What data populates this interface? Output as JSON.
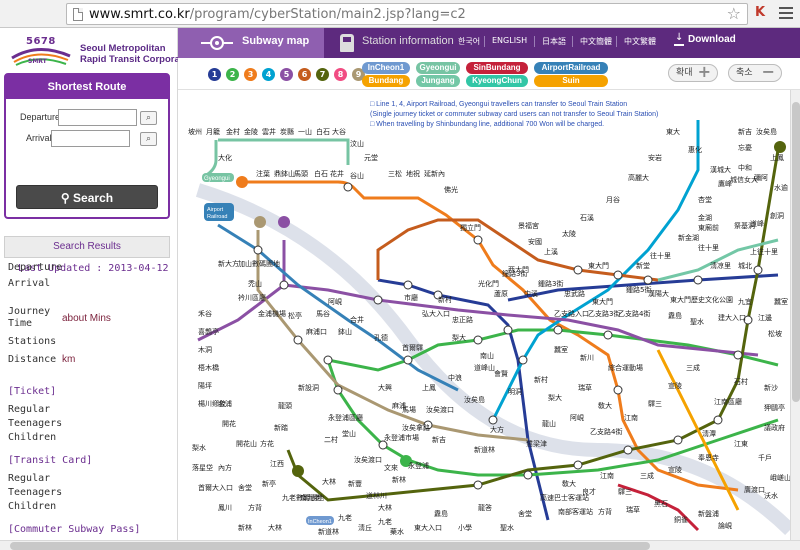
{
  "browser": {
    "url_host": "www.smrt.co.kr",
    "url_path": "/program/cyberStation/main2.jsp?lang=c2"
  },
  "logo": {
    "number": "5678",
    "sub": "SMRT",
    "line1": "Seoul Metropolitan",
    "line2": "Rapid Transit Corporation"
  },
  "route": {
    "title": "Shortest Route",
    "departure_label": "Departure",
    "arrival_label": "Arrival",
    "departure_value": "",
    "arrival_value": "",
    "search_label": "Search"
  },
  "results": {
    "title": "Search Results",
    "last_updated": "Last Updated : 2013-04-12",
    "departure_label": "Departure",
    "arrival_label": "Arrival",
    "journey_label_1": "Journey",
    "journey_label_2": "Time",
    "journey_value": "about Mins",
    "stations_label": "Stations",
    "distance_label": "Distance",
    "distance_value": "km"
  },
  "fares": {
    "ticket_head": "[Ticket]",
    "transit_head": "[Transit Card]",
    "pass_head": "[Commuter Subway Pass]",
    "regular": "Regular",
    "teenagers": "Teenagers",
    "children": "Children"
  },
  "nav": {
    "subway_map": "Subway map",
    "station_info": "Station information",
    "languages": [
      "한국어",
      "ENGLISH",
      "日本語",
      "中文簡體",
      "中文繁體"
    ],
    "download": "Download"
  },
  "lines": {
    "numbers": [
      "1",
      "2",
      "3",
      "4",
      "5",
      "6",
      "7",
      "8",
      "9"
    ],
    "colors": [
      "#263c96",
      "#3cb44a",
      "#ef7c1c",
      "#00a2d1",
      "#8b50a4",
      "#c55c1d",
      "#54640d",
      "#f14c82",
      "#aa9872"
    ],
    "named": [
      {
        "name": "InCheon1",
        "color": "#6f99d0"
      },
      {
        "name": "Gyeongui",
        "color": "#77c4a3"
      },
      {
        "name": "SinBundang",
        "color": "#c5213a"
      },
      {
        "name": "AirportRailroad",
        "color": "#3681b7"
      },
      {
        "name": "Bundang",
        "color": "#f5a200"
      },
      {
        "name": "Jungang",
        "color": "#73c7a6"
      },
      {
        "name": "KyeongChun",
        "color": "#32c6a6"
      },
      {
        "name": "Suin",
        "color": "#f5a200"
      }
    ]
  },
  "zoom": {
    "in": "확대",
    "out": "축소"
  },
  "notice": {
    "line1": "□  Line 1, 4, Airport Railroad, Gyeongui  travellers can transfer to Seoul Train Station",
    "line2": "    (Single journey ticket or commuter subway card users can not transfer to Seoul Train Station)",
    "line3": "□  When travelling by Shinbundang line, additional 700 Won will be charged."
  },
  "map_labels": {
    "gyeongui_tag": "Gyeongui",
    "airport_tag": "Airport Railroad",
    "incheon_tag": "InCheon1",
    "stations": [
      "坡州",
      "月籠",
      "金村",
      "金陵",
      "雲井",
      "炭縣",
      "一山",
      "白石",
      "大谷",
      "汶山",
      "大化",
      "注葉",
      "鼎鉢山",
      "馬頭",
      "白石",
      "花井",
      "谷山",
      "元堂",
      "三松",
      "地祝",
      "延新內",
      "佛光",
      "獨立門",
      "景福宮",
      "安國",
      "鐘路3街",
      "東大門",
      "新堂",
      "淸凉里",
      "城北",
      "鍾路5街",
      "東廟前",
      "祭基洞",
      "往十里",
      "上往十里",
      "市廳",
      "乙支路入口",
      "乙支路3街",
      "乙支路4街",
      "東大門歷史文化公園",
      "忠正路",
      "光化門",
      "西大門",
      "首爾驛",
      "孔德",
      "合井",
      "弘大入口",
      "新村",
      "梨大",
      "阿峴",
      "麻浦口",
      "大興",
      "麻浦",
      "汝矣渡口",
      "汝矣島",
      "汝矣拿路",
      "永登浦區廳",
      "堂山",
      "永登浦市場",
      "新吉",
      "新道林",
      "大方",
      "鷺梁津",
      "龍山",
      "二村",
      "汝矣渡口",
      "新林",
      "大林",
      "九老",
      "新大方",
      "加山數碼團地",
      "禿山",
      "衿川區廳",
      "金浦機場",
      "松亭",
      "馬谷",
      "鉢山",
      "禾谷",
      "喜鵲亭",
      "木洞",
      "梧木橋",
      "陽坪",
      "楊川鄕校",
      "金浦",
      "開花",
      "開花山",
      "方花",
      "江西",
      "新亭",
      "九老數碼團地",
      "南九老",
      "大林",
      "新豐",
      "道林川",
      "文來",
      "永登浦",
      "新吉",
      "汝矣島",
      "上鳳",
      "忘憂",
      "中和",
      "鷹峰",
      "杏堂",
      "金湖",
      "新金湖",
      "往十里",
      "漢陽大",
      "纛島",
      "聖水",
      "建大入口",
      "九宜",
      "江邊",
      "蠶室",
      "松坡",
      "石村",
      "江南區廳",
      "淸潭",
      "江東",
      "千戶",
      "峨嵯山",
      "廣渡口",
      "沃水",
      "奉恩寺",
      "宣陵",
      "三成",
      "驛三",
      "江南",
      "良才",
      "敎大",
      "高速巴士客運站",
      "舍堂",
      "南部客運站",
      "方背",
      "瑞草",
      "黑石",
      "銅雀",
      "新盤浦",
      "論峴",
      "新沙",
      "狎鷗亭",
      "議政府",
      "道峰",
      "創洞",
      "水逾",
      "彌阿",
      "城信女大",
      "漢城大",
      "惠化",
      "東大",
      "安岩",
      "高麗大",
      "月谷",
      "石溪",
      "太陵",
      "上溪",
      "中溪",
      "蘆原",
      "道峰山",
      "中浪",
      "上鳳",
      "馬場",
      "新設洞",
      "龍頭",
      "新踏",
      "龍答",
      "聖水",
      "小學",
      "纛島",
      "東大入口",
      "藥水",
      "淸丘",
      "九老",
      "新道林",
      "大林",
      "新林",
      "鳳川",
      "首爾大入口",
      "落星垈",
      "梨水",
      "內方",
      "舍堂",
      "方背",
      "瑞草",
      "敎大",
      "江南",
      "驛三",
      "宣陵",
      "三成",
      "綜合運動場",
      "新川",
      "蠶室",
      "新村",
      "梨大",
      "阿峴",
      "乙支路4街",
      "鍾路3街",
      "忠武路",
      "東大門",
      "南山",
      "會賢",
      "明洞",
      "淑大入口",
      "三角地",
      "新龍山",
      "二村",
      "東作",
      "冠岳"
    ]
  }
}
